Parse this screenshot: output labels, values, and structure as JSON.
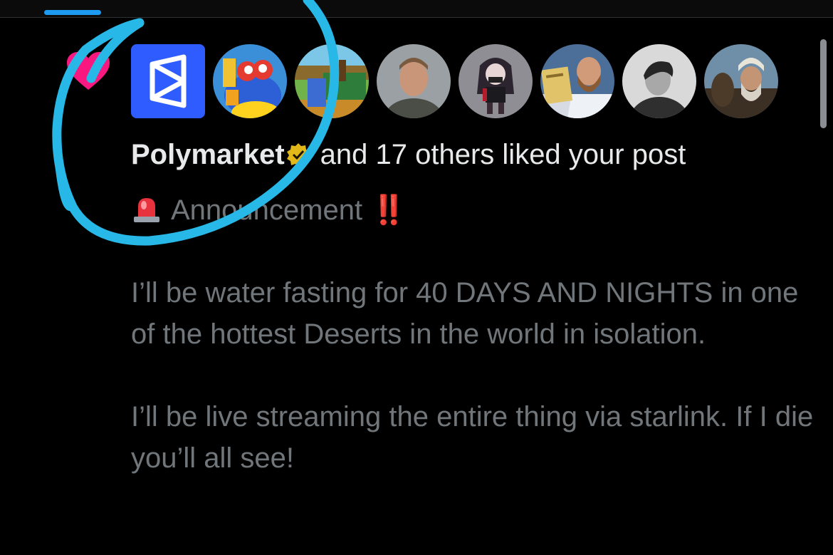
{
  "tabs": {
    "active_indicator_color": "#1d9bf0"
  },
  "notification": {
    "type_icon": "heart-icon",
    "avatars": [
      {
        "name": "Polymarket",
        "icon": "polymarket-logo"
      },
      {
        "name": "avatar-2",
        "icon": "cartoon-avatar"
      },
      {
        "name": "avatar-3",
        "icon": "pixel-art-avatar"
      },
      {
        "name": "avatar-4",
        "icon": "photo-avatar"
      },
      {
        "name": "avatar-5",
        "icon": "anime-avatar"
      },
      {
        "name": "avatar-6",
        "icon": "photo-avatar"
      },
      {
        "name": "avatar-7",
        "icon": "photo-avatar"
      },
      {
        "name": "avatar-8",
        "icon": "photo-avatar"
      }
    ],
    "liked_by_name": "Polymarket",
    "liked_rest": "and 17 others liked your post",
    "post": {
      "announcement_label": "Announcement",
      "exclamation": "‼️",
      "paragraph_1": "I’ll be water fasting for 40 DAYS AND NIGHTS in one of the hottest Deserts in the world in isolation.",
      "paragraph_2": "I’ll be live streaming the entire thing via starlink. If I die you’ll all see!"
    }
  },
  "colors": {
    "background": "#000000",
    "name_text": "#e7e9ea",
    "post_text": "#71767b",
    "heart": "#f91880",
    "circle_annotation": "#27b8e8",
    "exclamation": "#e0202d"
  }
}
